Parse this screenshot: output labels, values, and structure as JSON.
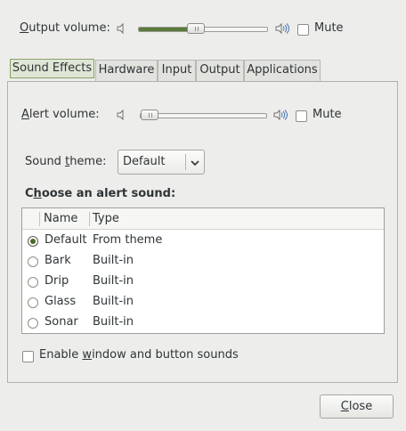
{
  "output": {
    "label_pre": "O",
    "label_rest": "utput volume:",
    "volume_fraction": 0.45,
    "mute_label": "Mute",
    "muted": false
  },
  "tabs": [
    {
      "label": "Sound Effects",
      "active": true
    },
    {
      "label": "Hardware",
      "active": false
    },
    {
      "label": "Input",
      "active": false
    },
    {
      "label": "Output",
      "active": false
    },
    {
      "label": "Applications",
      "active": false
    }
  ],
  "alert": {
    "label_pre": "A",
    "label_rest": "lert volume:",
    "volume_fraction": 0.0,
    "mute_label": "Mute",
    "muted": false
  },
  "theme": {
    "label_pre": "Sound ",
    "label_u": "t",
    "label_rest": "heme:",
    "value": "Default"
  },
  "choose": {
    "pre": "C",
    "u": "h",
    "rest": "oose an alert sound:"
  },
  "list": {
    "col_name": "Name",
    "col_type": "Type",
    "rows": [
      {
        "name": "Default",
        "type": "From theme",
        "selected": true
      },
      {
        "name": "Bark",
        "type": "Built-in",
        "selected": false
      },
      {
        "name": "Drip",
        "type": "Built-in",
        "selected": false
      },
      {
        "name": "Glass",
        "type": "Built-in",
        "selected": false
      },
      {
        "name": "Sonar",
        "type": "Built-in",
        "selected": false
      }
    ]
  },
  "enable_sounds": {
    "pre": "Enable ",
    "u": "w",
    "rest": "indow and button sounds",
    "checked": false
  },
  "close_button": {
    "u": "C",
    "rest": "lose"
  },
  "colors": {
    "accent": "#5b7a3a",
    "active_tab": "#dfe6d6"
  }
}
